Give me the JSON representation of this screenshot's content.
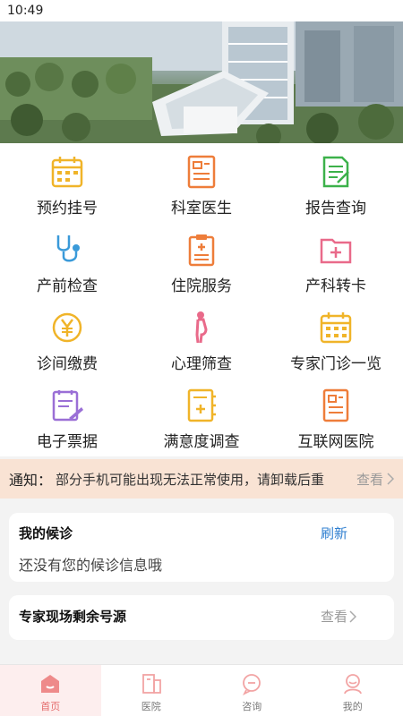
{
  "status_bar": {
    "time": "10:49"
  },
  "menu": [
    {
      "label": "预约挂号",
      "icon": "calendar-icon"
    },
    {
      "label": "科室医生",
      "icon": "doctor-list-icon"
    },
    {
      "label": "报告查询",
      "icon": "report-icon"
    },
    {
      "label": "产前检查",
      "icon": "stethoscope-icon"
    },
    {
      "label": "住院服务",
      "icon": "clipboard-icon"
    },
    {
      "label": "产科转卡",
      "icon": "folder-medical-icon"
    },
    {
      "label": "诊间缴费",
      "icon": "yuan-icon"
    },
    {
      "label": "心理筛查",
      "icon": "pregnant-woman-icon"
    },
    {
      "label": "专家门诊一览",
      "icon": "calendar-expert-icon"
    },
    {
      "label": "电子票据",
      "icon": "e-receipt-icon"
    },
    {
      "label": "满意度调查",
      "icon": "survey-icon"
    },
    {
      "label": "互联网医院",
      "icon": "internet-hospital-icon"
    }
  ],
  "notice": {
    "title": "通知：",
    "text": "部分手机可能出现无法正常使用，请卸载后重新下载",
    "more": "查看"
  },
  "waiting": {
    "title": "我的候诊",
    "refresh": "刷新",
    "empty": "还没有您的候诊信息哦"
  },
  "expert_slots": {
    "title": "专家现场剩余号源",
    "more": "查看"
  },
  "bottom_nav": [
    {
      "label": "首页",
      "icon": "home-icon",
      "active": true
    },
    {
      "label": "医院",
      "icon": "hospital-icon",
      "active": false
    },
    {
      "label": "咨询",
      "icon": "consult-icon",
      "active": false
    },
    {
      "label": "我的",
      "icon": "profile-icon",
      "active": false
    }
  ],
  "colors": {
    "accent": "#e46b6b",
    "notice_bg": "#f9e3d4",
    "link_blue": "#2f7fd0",
    "icon_yellow": "#f0b429",
    "icon_orange": "#ee7d3a",
    "icon_green": "#3cb14a",
    "icon_blue": "#3a9ad9",
    "icon_pink": "#e96a8a",
    "icon_purple": "#9a6fd6"
  }
}
